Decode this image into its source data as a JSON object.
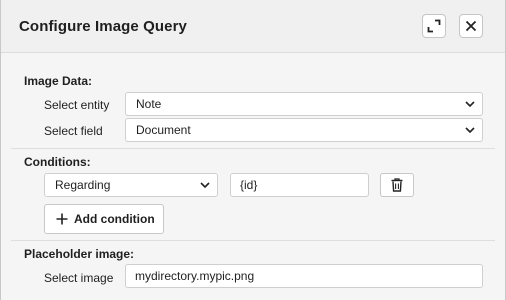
{
  "dialog": {
    "title": "Configure Image Query",
    "expand_icon": "expand-icon",
    "close_icon": "close-icon"
  },
  "image_data": {
    "heading": "Image Data:",
    "entity_label": "Select entity",
    "entity_value": "Note",
    "field_label": "Select field",
    "field_value": "Document"
  },
  "conditions": {
    "heading": "Conditions:",
    "items": [
      {
        "field": "Regarding",
        "value": "{id}",
        "delete_icon": "trash-icon"
      }
    ],
    "add_label": "Add condition",
    "add_icon": "plus-icon"
  },
  "placeholder": {
    "heading": "Placeholder image:",
    "image_label": "Select image",
    "image_value": "mydirectory.mypic.png"
  }
}
